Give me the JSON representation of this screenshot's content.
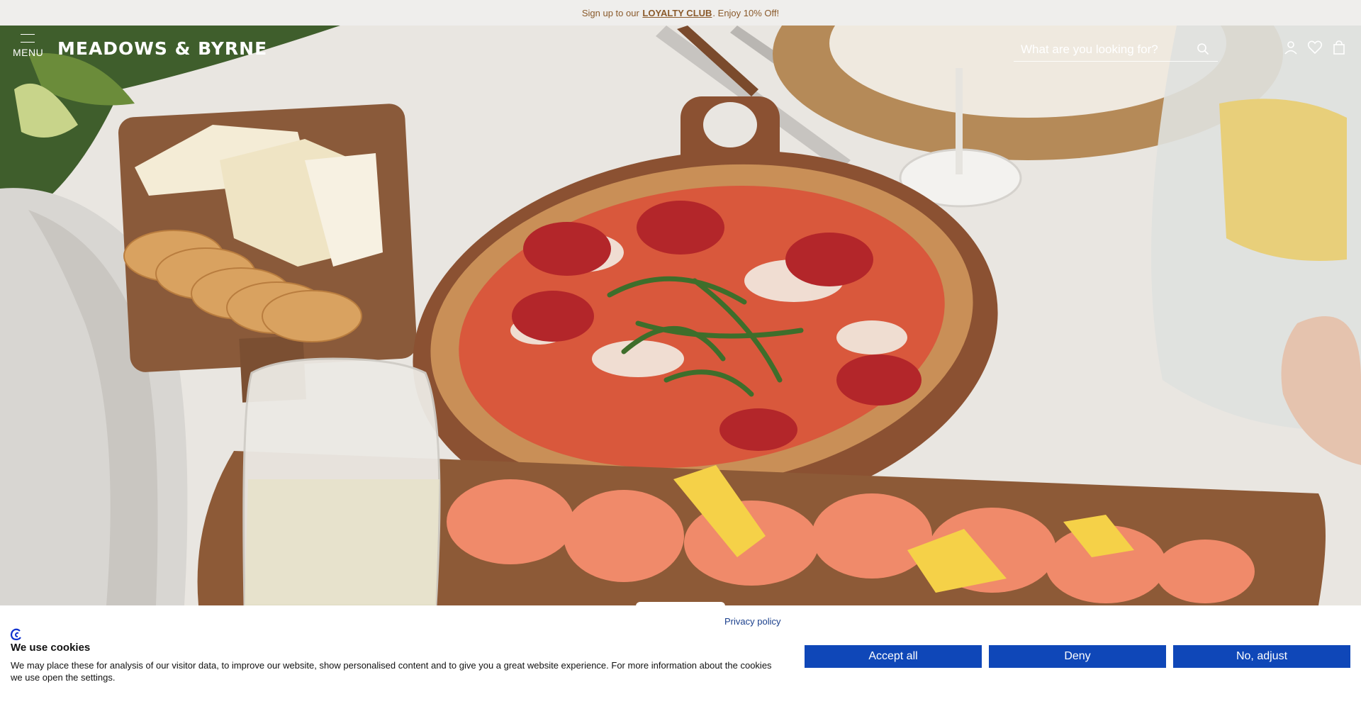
{
  "announcement": {
    "prefix": "Sign up to our ",
    "link": "LOYALTY CLUB",
    "suffix": ". Enjoy 10% Off!"
  },
  "header": {
    "menu_label": "MENU",
    "logo": "MEADOWS & BYRNE",
    "search_placeholder": "What are you looking for?",
    "icons": [
      "menu-icon",
      "search-icon",
      "account-icon",
      "wishlist-heart-icon",
      "cart-bag-icon"
    ]
  },
  "cookie_banner": {
    "privacy_link": "Privacy policy",
    "title": "We use cookies",
    "body": "We may place these for analysis of our visitor data, to improve our website, show personalised content and to give you a great website experience. For more information about the cookies we use open the settings.",
    "buttons": {
      "accept": "Accept all",
      "deny": "Deny",
      "adjust": "No, adjust"
    }
  },
  "colors": {
    "announcement_bg": "#efeeec",
    "announcement_text": "#8a5a2b",
    "button_blue": "#0f47b8",
    "privacy_link": "#1a3f8c"
  }
}
